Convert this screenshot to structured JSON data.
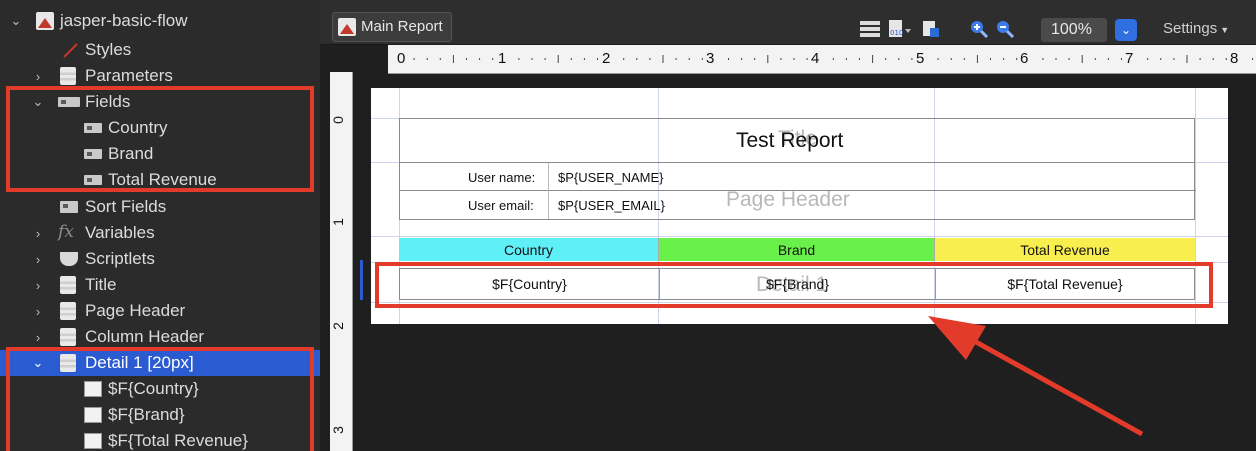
{
  "outline": {
    "items": [
      {
        "label": "jasper-basic-flow",
        "icon": "report-icon"
      },
      {
        "label": "Styles",
        "icon": "styles-icon"
      },
      {
        "label": "Parameters",
        "icon": "parameters-icon"
      },
      {
        "label": "Fields",
        "icon": "field-icon"
      },
      {
        "label": "Country",
        "icon": "field-icon"
      },
      {
        "label": "Brand",
        "icon": "field-icon"
      },
      {
        "label": "Total Revenue",
        "icon": "field-icon"
      },
      {
        "label": "Sort Fields",
        "icon": "sort-fields-icon"
      },
      {
        "label": "Variables",
        "icon": "variables-icon"
      },
      {
        "label": "Scriptlets",
        "icon": "scriptlets-icon"
      },
      {
        "label": "Title",
        "icon": "band-icon"
      },
      {
        "label": "Page Header",
        "icon": "band-icon"
      },
      {
        "label": "Column Header",
        "icon": "band-icon"
      },
      {
        "label": "Detail 1 [20px]",
        "icon": "band-icon"
      },
      {
        "label": "$F{Country}",
        "icon": "textfield-icon"
      },
      {
        "label": "$F{Brand}",
        "icon": "textfield-icon"
      },
      {
        "label": "$F{Total Revenue}",
        "icon": "textfield-icon"
      }
    ]
  },
  "toolbar": {
    "tab_label": "Main Report",
    "zoom": "100%",
    "settings_label": "Settings"
  },
  "ruler": {
    "h_numbers": [
      "0",
      "1",
      "2",
      "3",
      "4",
      "5",
      "6",
      "7",
      "8"
    ],
    "v_numbers": [
      "0",
      "1",
      "2",
      "3"
    ]
  },
  "report": {
    "title": "Test Report",
    "title_ghost": "Title",
    "user_name_label": "User name:",
    "user_name_value": "$P{USER_NAME}",
    "user_email_label": "User email:",
    "user_email_value": "$P{USER_EMAIL}",
    "page_header_ghost": "Page Header",
    "column_headers": [
      "Country",
      "Brand",
      "Total Revenue"
    ],
    "detail_cells": [
      "$F{Country}",
      "$F{Brand}",
      "$F{Total Revenue}"
    ],
    "detail_ghost": "Detail 1"
  },
  "colors": {
    "country_header": "#5ef0f6",
    "brand_header": "#6af04a",
    "revenue_header": "#f8ef4e",
    "highlight": "#e23b2a",
    "selection": "#2a5bd0"
  }
}
